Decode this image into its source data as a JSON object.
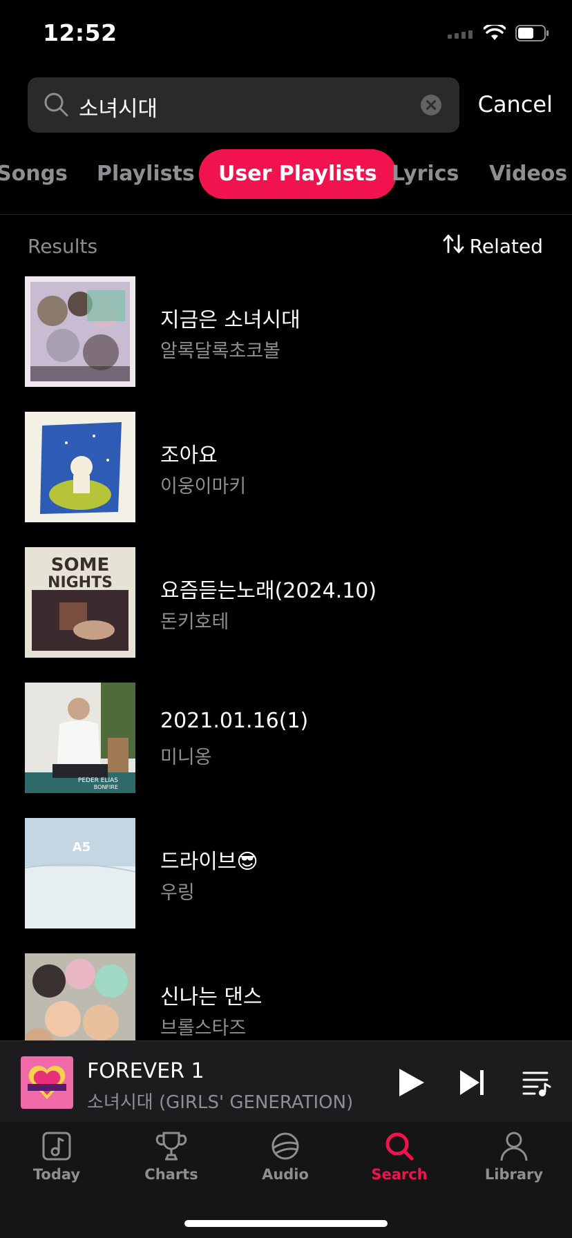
{
  "status": {
    "time": "12:52"
  },
  "search": {
    "query": "소녀시대",
    "cancel_label": "Cancel"
  },
  "tabs": [
    {
      "label": "Songs"
    },
    {
      "label": "Playlists"
    },
    {
      "label": "User Playlists",
      "active": true
    },
    {
      "label": "Lyrics"
    },
    {
      "label": "Videos"
    }
  ],
  "results": {
    "label": "Results",
    "sort_label": "Related"
  },
  "playlists": [
    {
      "title": "지금은 소녀시대",
      "owner": "알록달록초코볼"
    },
    {
      "title": "조아요",
      "owner": "이웅이마키"
    },
    {
      "title": "요즘듣는노래(2024.10)",
      "owner": "돈키호테",
      "cover_text": "SOME NIGHTS"
    },
    {
      "title": "2021.01.16(1)",
      "owner": "미니옹",
      "cover_text": "PEDER ELIAS BONFIRE"
    },
    {
      "title": "드라이브😎",
      "owner": "우링"
    },
    {
      "title": "신나는 댄스",
      "owner": "브롤스타즈"
    }
  ],
  "now_playing": {
    "title": "FOREVER 1",
    "artist": "소녀시대 (GIRLS' GENERATION)"
  },
  "tab_bar": [
    {
      "label": "Today",
      "icon": "music-note-icon"
    },
    {
      "label": "Charts",
      "icon": "trophy-icon"
    },
    {
      "label": "Audio",
      "icon": "planet-icon"
    },
    {
      "label": "Search",
      "icon": "search-icon",
      "active": true
    },
    {
      "label": "Library",
      "icon": "person-icon"
    }
  ],
  "colors": {
    "accent": "#f0134d",
    "background": "#000000",
    "muted": "#8e8e93"
  }
}
